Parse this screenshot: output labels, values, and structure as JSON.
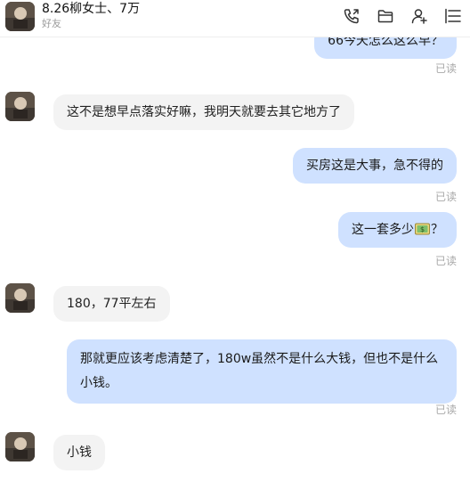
{
  "header": {
    "title": "8.26柳女士、7万",
    "subtitle": "好友",
    "icons": [
      "phone-icon",
      "folder-icon",
      "add-contact-icon",
      "menu-icon"
    ]
  },
  "messages": [
    {
      "id": "m0",
      "side": "out",
      "text": "66今天怎么这么早？",
      "status": "已读"
    },
    {
      "id": "m1",
      "side": "in",
      "text": "这不是想早点落实好嘛，我明天就要去其它地方了"
    },
    {
      "id": "m2",
      "side": "out",
      "text": "买房这是大事，急不得的",
      "status": "已读"
    },
    {
      "id": "m3",
      "side": "out",
      "text_before": "这一套多少",
      "emoji": "money-emoji",
      "text_after": "？",
      "status": "已读"
    },
    {
      "id": "m4",
      "side": "in",
      "text": "180，77平左右"
    },
    {
      "id": "m5",
      "side": "out",
      "text": "那就更应该考虑清楚了，180w虽然不是什么大钱，但也不是什么小钱。",
      "status": "已读"
    },
    {
      "id": "m6",
      "side": "in",
      "text": "小钱"
    }
  ],
  "colors": {
    "bubble_out": "#cfe1ff",
    "bubble_in": "#f3f3f3",
    "read_status": "#a8a8a8"
  }
}
